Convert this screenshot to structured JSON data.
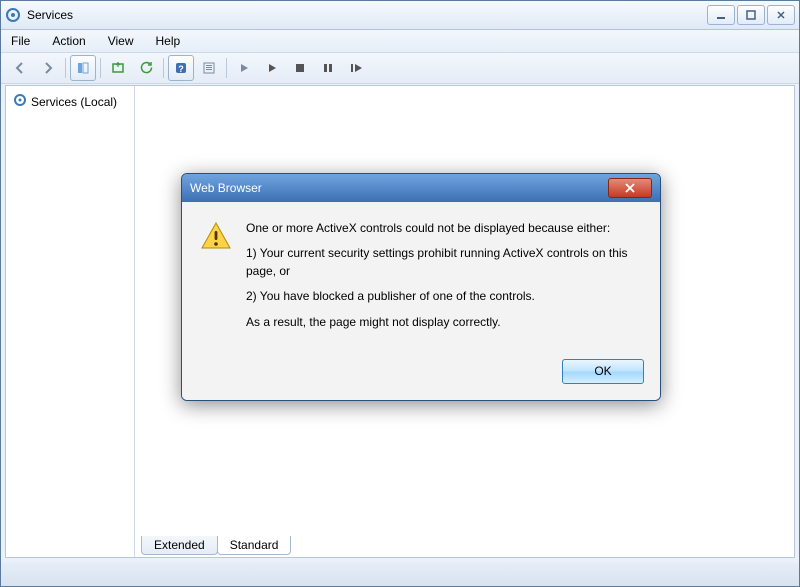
{
  "window": {
    "title": "Services"
  },
  "menu": {
    "file": "File",
    "action": "Action",
    "view": "View",
    "help": "Help"
  },
  "tree": {
    "root_label": "Services (Local)"
  },
  "tabs": {
    "extended": "Extended",
    "standard": "Standard"
  },
  "dialog": {
    "title": "Web Browser",
    "line1": "One or more ActiveX controls could not be displayed because either:",
    "line2": "1) Your current security settings prohibit running ActiveX controls on this page, or",
    "line3": "2) You have blocked a publisher of one of the controls.",
    "line4": "As a result, the page might not display correctly.",
    "ok": "OK"
  }
}
